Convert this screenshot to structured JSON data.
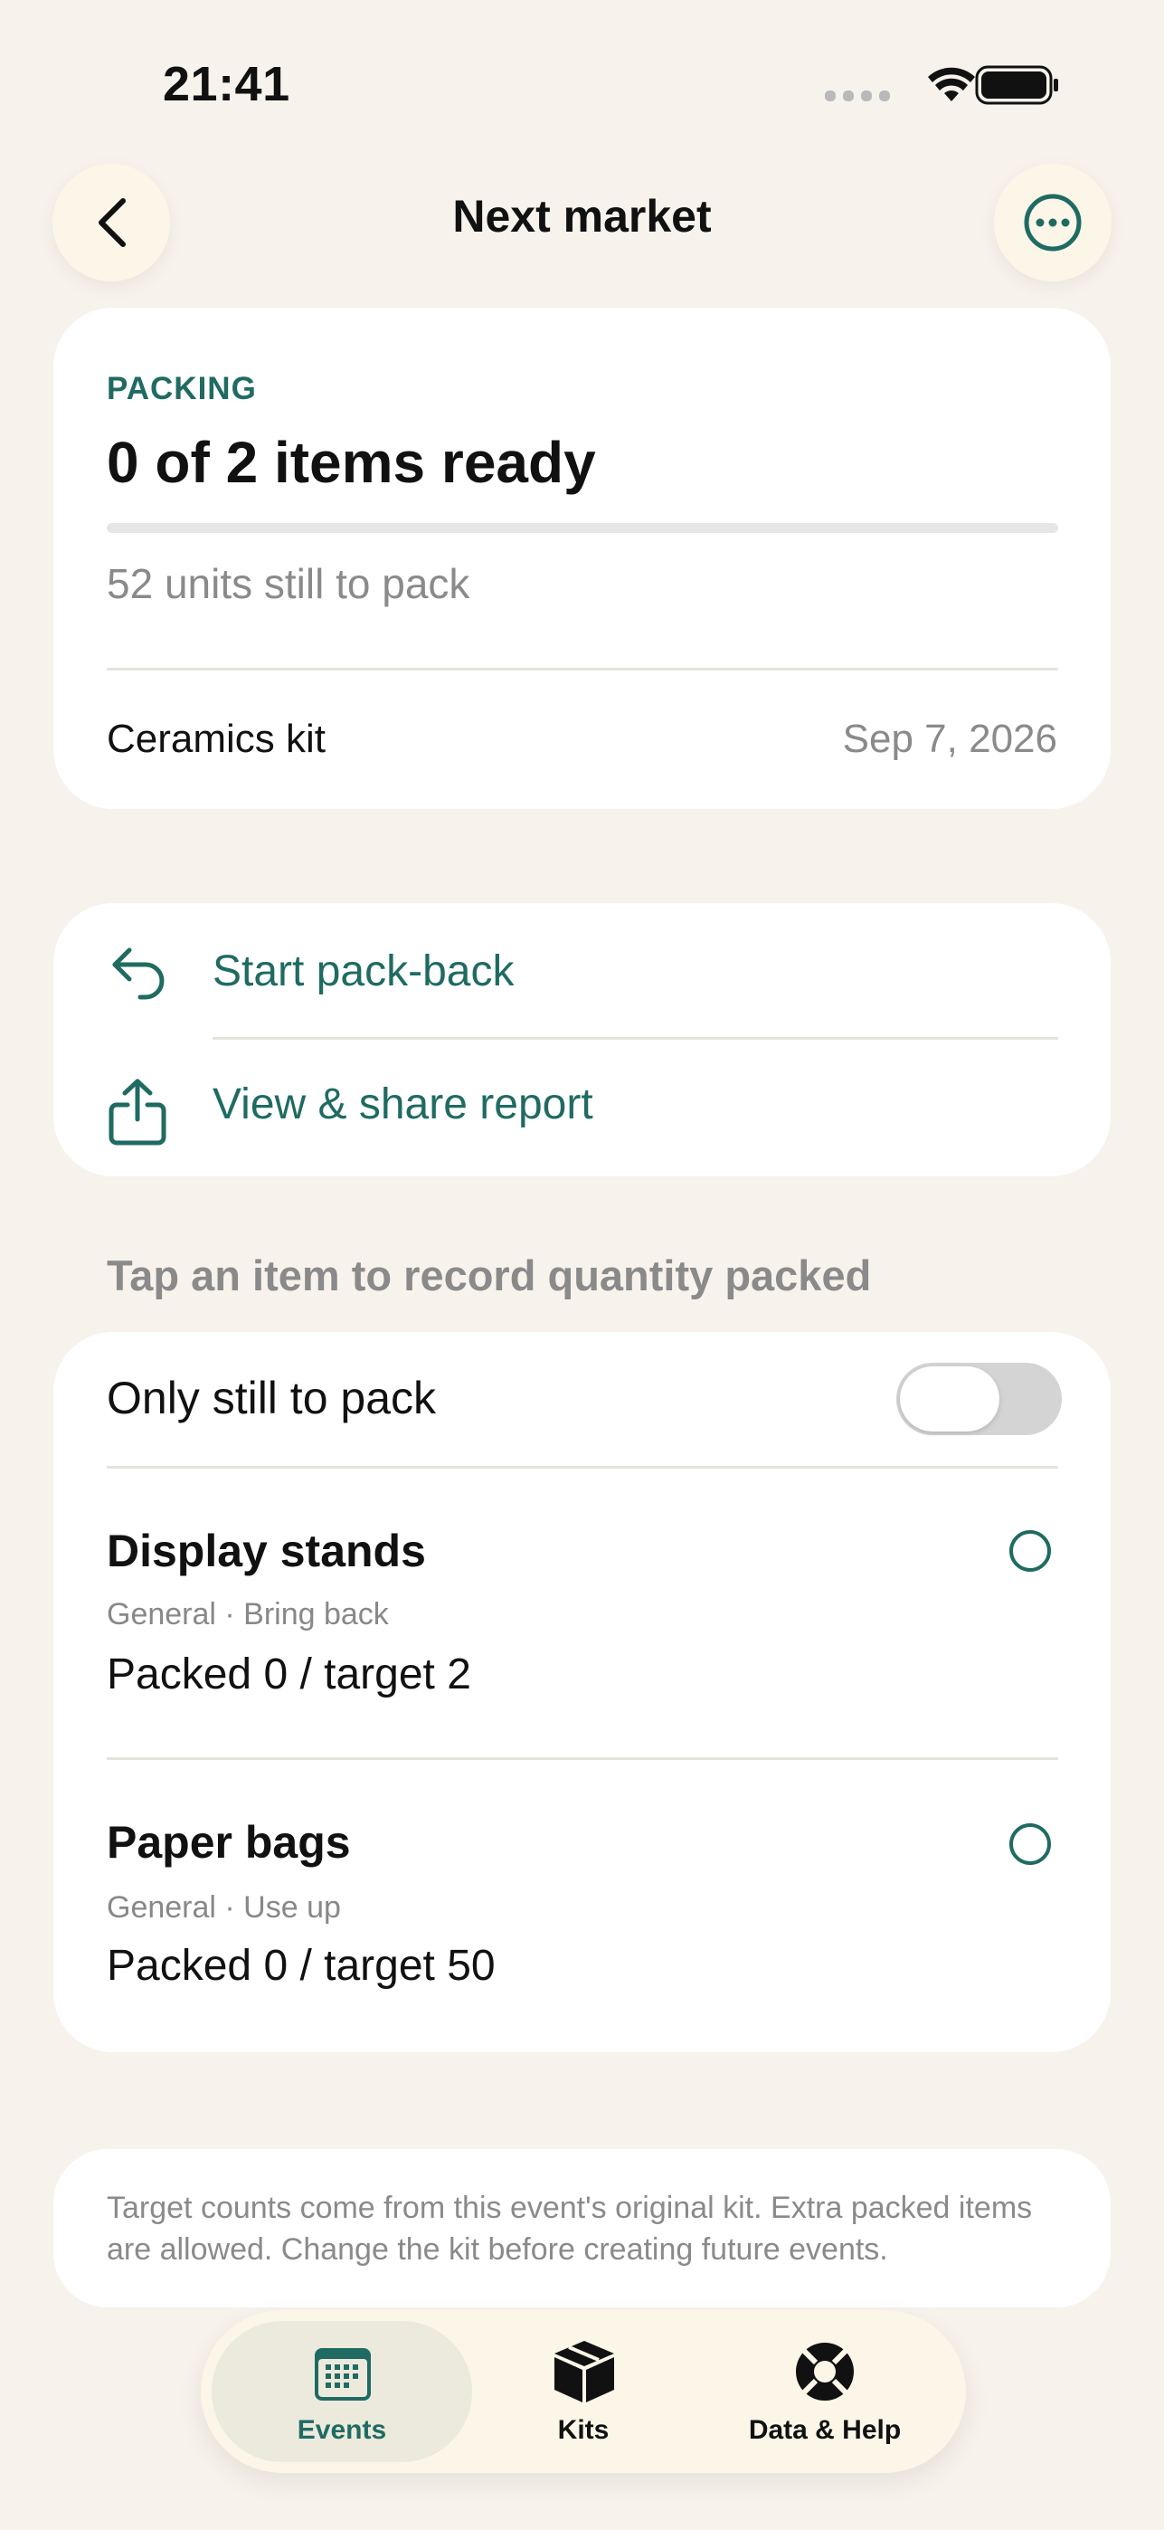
{
  "status_bar": {
    "time": "21:41"
  },
  "nav": {
    "title": "Next market"
  },
  "packing_card": {
    "eyebrow": "PACKING",
    "headline": "0 of 2 items ready",
    "progress": 0,
    "units_left": "52 units still to pack",
    "kit_name": "Ceramics kit",
    "date": "Sep 7, 2026"
  },
  "actions": [
    {
      "label": "Start pack-back",
      "icon": "undo-arrow-icon"
    },
    {
      "label": "View & share report",
      "icon": "share-icon"
    }
  ],
  "items_section": {
    "hint": "Tap an item to record quantity packed",
    "filter_label": "Only still to pack",
    "filter_on": false,
    "items": [
      {
        "name": "Display stands",
        "meta": "General · Bring back",
        "count": "Packed 0 / target 2"
      },
      {
        "name": "Paper bags",
        "meta": "General · Use up",
        "count": "Packed 0 / target 50"
      }
    ]
  },
  "footnote": "Target counts come from this event's original kit. Extra packed items are allowed. Change the kit before creating future events.",
  "tabs": [
    {
      "label": "Events",
      "icon": "calendar-icon",
      "active": true
    },
    {
      "label": "Kits",
      "icon": "box-icon",
      "active": false
    },
    {
      "label": "Data & Help",
      "icon": "lifebuoy-icon",
      "active": false
    }
  ],
  "colors": {
    "accent": "#1f6b62",
    "background": "#f7f3ec",
    "card": "#ffffff"
  }
}
